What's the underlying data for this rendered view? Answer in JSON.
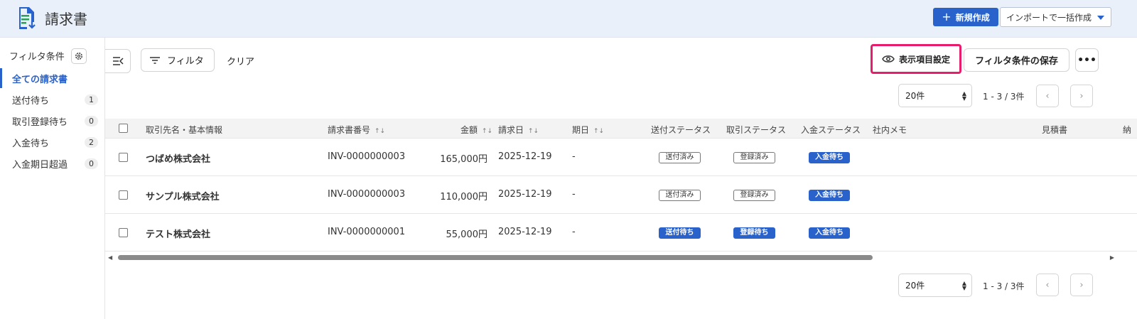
{
  "header": {
    "title": "請求書",
    "new_button": "新規作成",
    "import_button": "インポートで一括作成",
    "accent": "#2a62cc"
  },
  "sidebar": {
    "heading": "フィルタ条件",
    "items": [
      {
        "label": "全ての請求書",
        "count": ""
      },
      {
        "label": "送付待ち",
        "count": "1"
      },
      {
        "label": "取引登録待ち",
        "count": "0"
      },
      {
        "label": "入金待ち",
        "count": "2"
      },
      {
        "label": "入金期日超過",
        "count": "0"
      }
    ]
  },
  "toolbar": {
    "filter_label": "フィルタ",
    "clear_label": "クリア",
    "display_settings_label": "表示項目設定",
    "save_filter_label": "フィルタ条件の保存",
    "more_label": "•••",
    "highlight_color": "#e81c6c"
  },
  "pagination": {
    "per_page": "20件",
    "info": "1 - 3 / 3件"
  },
  "table": {
    "columns": [
      "取引先名・基本情報",
      "請求書番号",
      "金額",
      "請求日",
      "期日",
      "送付ステータス",
      "取引ステータス",
      "入金ステータス",
      "社内メモ",
      "見積書",
      "納"
    ],
    "rows": [
      {
        "client": "つばめ株式会社",
        "number": "INV-0000000003",
        "amount": "165,000円",
        "date": "2025-12-19",
        "due": "-",
        "send": "送付済み",
        "deal": "登録済み",
        "payment": "入金待ち"
      },
      {
        "client": "サンプル株式会社",
        "number": "INV-0000000003",
        "amount": "110,000円",
        "date": "2025-12-19",
        "due": "-",
        "send": "送付済み",
        "deal": "登録済み",
        "payment": "入金待ち"
      },
      {
        "client": "テスト株式会社",
        "number": "INV-0000000001",
        "amount": "55,000円",
        "date": "2025-12-19",
        "due": "-",
        "send": "送付待ち",
        "deal": "登録待ち",
        "payment": "入金待ち"
      }
    ]
  }
}
